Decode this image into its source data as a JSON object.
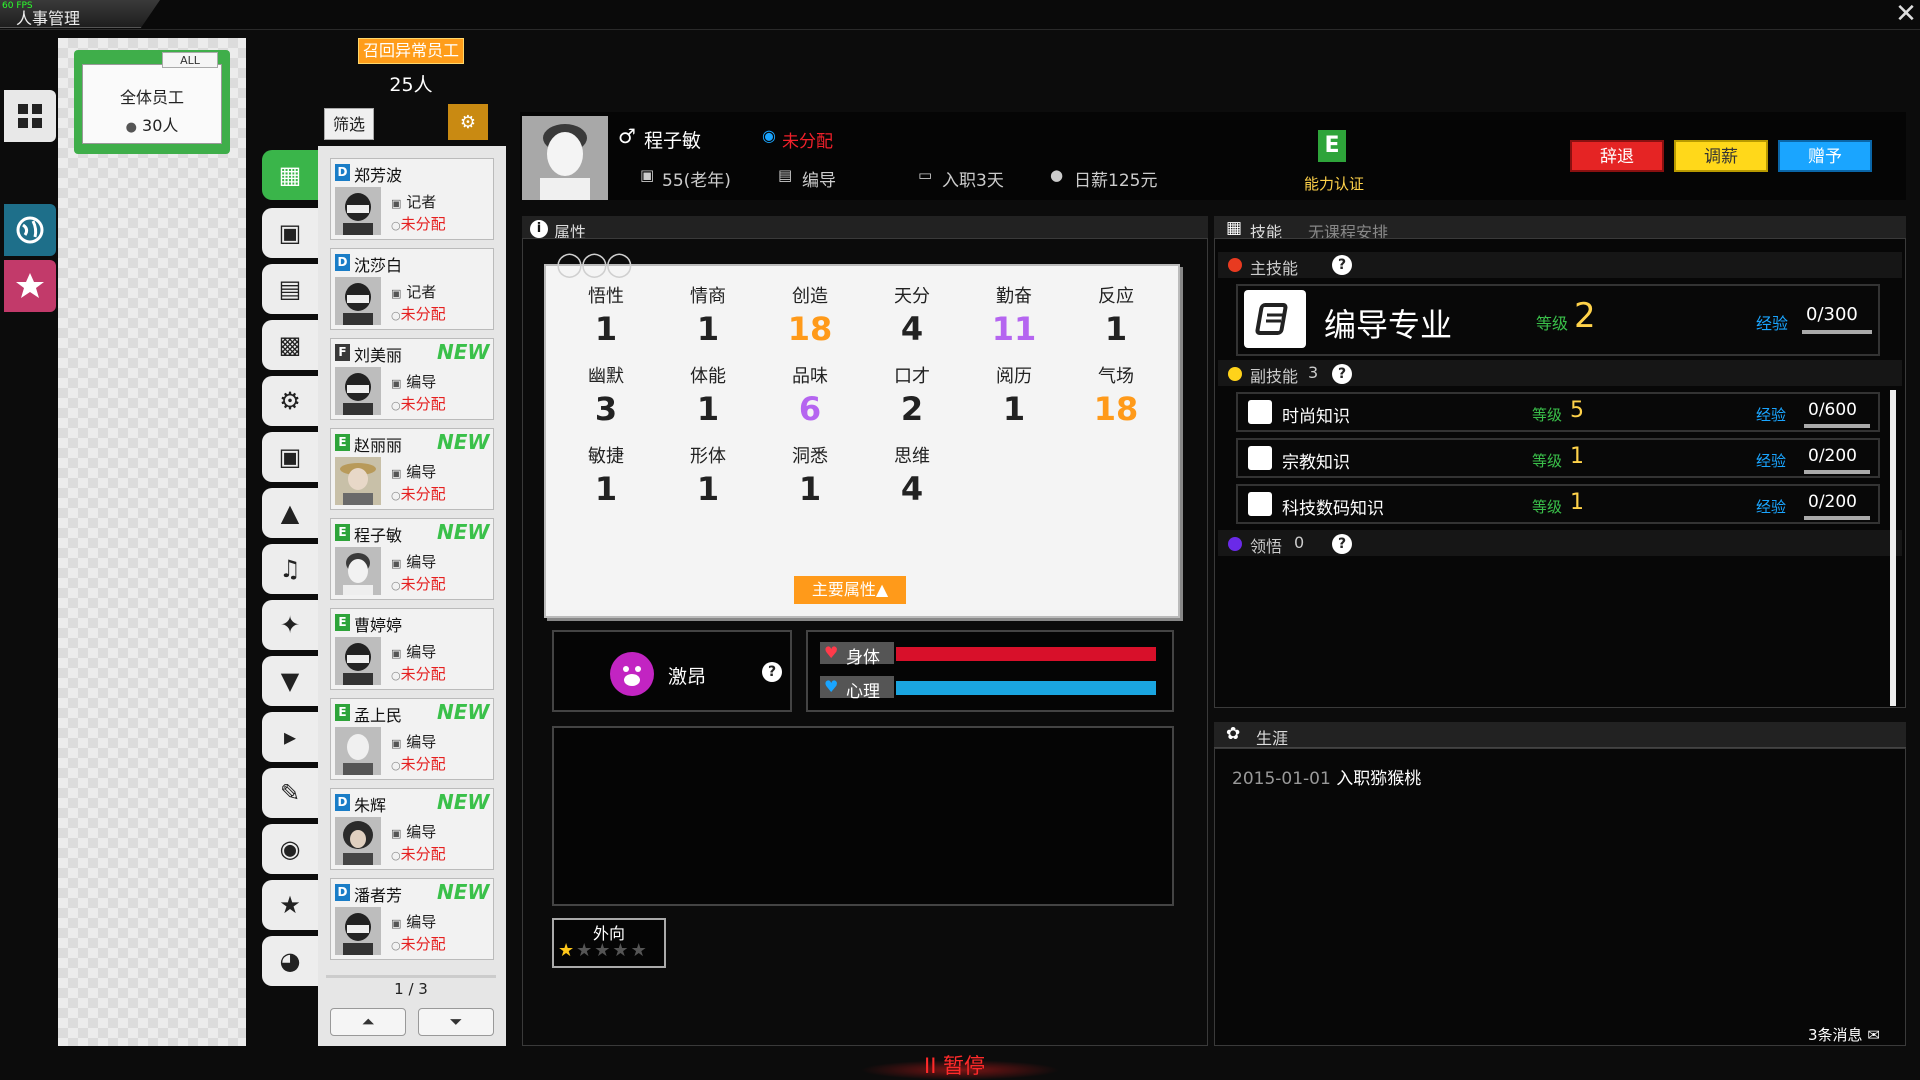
{
  "window": {
    "title": "人事管理",
    "fps": "60 FPS",
    "close_label": "✕"
  },
  "folder": {
    "tag": "ALL",
    "title": "全体员工",
    "count": "30人"
  },
  "roster": {
    "recall_label": "召回异常员工",
    "count": "25人",
    "filter_label": "筛选"
  },
  "employees": [
    {
      "grade": "D",
      "name": "郑芳波",
      "role": "记者",
      "status": "未分配",
      "new": ""
    },
    {
      "grade": "D",
      "name": "沈莎白",
      "role": "记者",
      "status": "未分配",
      "new": ""
    },
    {
      "grade": "F",
      "name": "刘美丽",
      "role": "编导",
      "status": "未分配",
      "new": "NEW"
    },
    {
      "grade": "E",
      "name": "赵丽丽",
      "role": "编导",
      "status": "未分配",
      "new": "NEW"
    },
    {
      "grade": "E",
      "name": "程子敏",
      "role": "编导",
      "status": "未分配",
      "new": "NEW"
    },
    {
      "grade": "E",
      "name": "曹婷婷",
      "role": "编导",
      "status": "未分配",
      "new": ""
    },
    {
      "grade": "E",
      "name": "孟上民",
      "role": "编导",
      "status": "未分配",
      "new": "NEW"
    },
    {
      "grade": "D",
      "name": "朱辉",
      "role": "编导",
      "status": "未分配",
      "new": "NEW"
    },
    {
      "grade": "D",
      "name": "潘者芳",
      "role": "编导",
      "status": "未分配",
      "new": "NEW"
    }
  ],
  "pager": {
    "label": "1 / 3",
    "first_label": "⏶",
    "last_label": "⏷"
  },
  "profile": {
    "name": "程子敏",
    "assign_status": "未分配",
    "age": "55(老年)",
    "role": "编导",
    "tenure": "入职3天",
    "salary": "日薪125元",
    "cert_grade": "E",
    "cert_label": "能力认证",
    "buttons": {
      "fire": "辞退",
      "pay": "调薪",
      "gift": "赠予"
    }
  },
  "attributes": {
    "section_title": "属性",
    "items": [
      {
        "name": "悟性",
        "value": "1",
        "color": "#222222"
      },
      {
        "name": "情商",
        "value": "1",
        "color": "#222222"
      },
      {
        "name": "创造",
        "value": "18",
        "color": "#ff9a1a"
      },
      {
        "name": "天分",
        "value": "4",
        "color": "#222222"
      },
      {
        "name": "勤奋",
        "value": "11",
        "color": "#b565f0"
      },
      {
        "name": "反应",
        "value": "1",
        "color": "#222222"
      },
      {
        "name": "幽默",
        "value": "3",
        "color": "#222222"
      },
      {
        "name": "体能",
        "value": "1",
        "color": "#222222"
      },
      {
        "name": "品味",
        "value": "6",
        "color": "#b565f0"
      },
      {
        "name": "口才",
        "value": "2",
        "color": "#222222"
      },
      {
        "name": "阅历",
        "value": "1",
        "color": "#222222"
      },
      {
        "name": "气场",
        "value": "18",
        "color": "#ff9a1a"
      },
      {
        "name": "敏捷",
        "value": "1",
        "color": "#222222"
      },
      {
        "name": "形体",
        "value": "1",
        "color": "#222222"
      },
      {
        "name": "洞悉",
        "value": "1",
        "color": "#222222"
      },
      {
        "name": "思维",
        "value": "4",
        "color": "#222222"
      }
    ],
    "main_button": "主要属性▲"
  },
  "mood": {
    "label": "激昂",
    "help": "?"
  },
  "health": {
    "body_label": "身体",
    "mind_label": "心理",
    "body_level": 1.0,
    "mind_level": 1.0
  },
  "trait": {
    "label": "外向",
    "stars_filled": 1,
    "stars_total": 5
  },
  "skills": {
    "section_title": "技能",
    "schedule": "无课程安排",
    "main_label": "主技能",
    "main": {
      "name": "编导专业",
      "level_label": "等级",
      "level": "2",
      "exp_label": "经验",
      "exp": "0/300"
    },
    "sub_label": "副技能",
    "sub_count": "3",
    "sub": [
      {
        "name": "时尚知识",
        "level_label": "等级",
        "level": "5",
        "exp_label": "经验",
        "exp": "0/600"
      },
      {
        "name": "宗教知识",
        "level_label": "等级",
        "level": "1",
        "exp_label": "经验",
        "exp": "0/200"
      },
      {
        "name": "科技数码知识",
        "level_label": "等级",
        "level": "1",
        "exp_label": "经验",
        "exp": "0/200"
      }
    ],
    "insight_label": "领悟",
    "insight_count": "0"
  },
  "career": {
    "section_title": "生涯",
    "entries": [
      {
        "date": "2015-01-01",
        "text": "入职猕猴桃"
      }
    ],
    "messages": "3条消息"
  },
  "footer": {
    "pause_label": "II 暂停"
  }
}
